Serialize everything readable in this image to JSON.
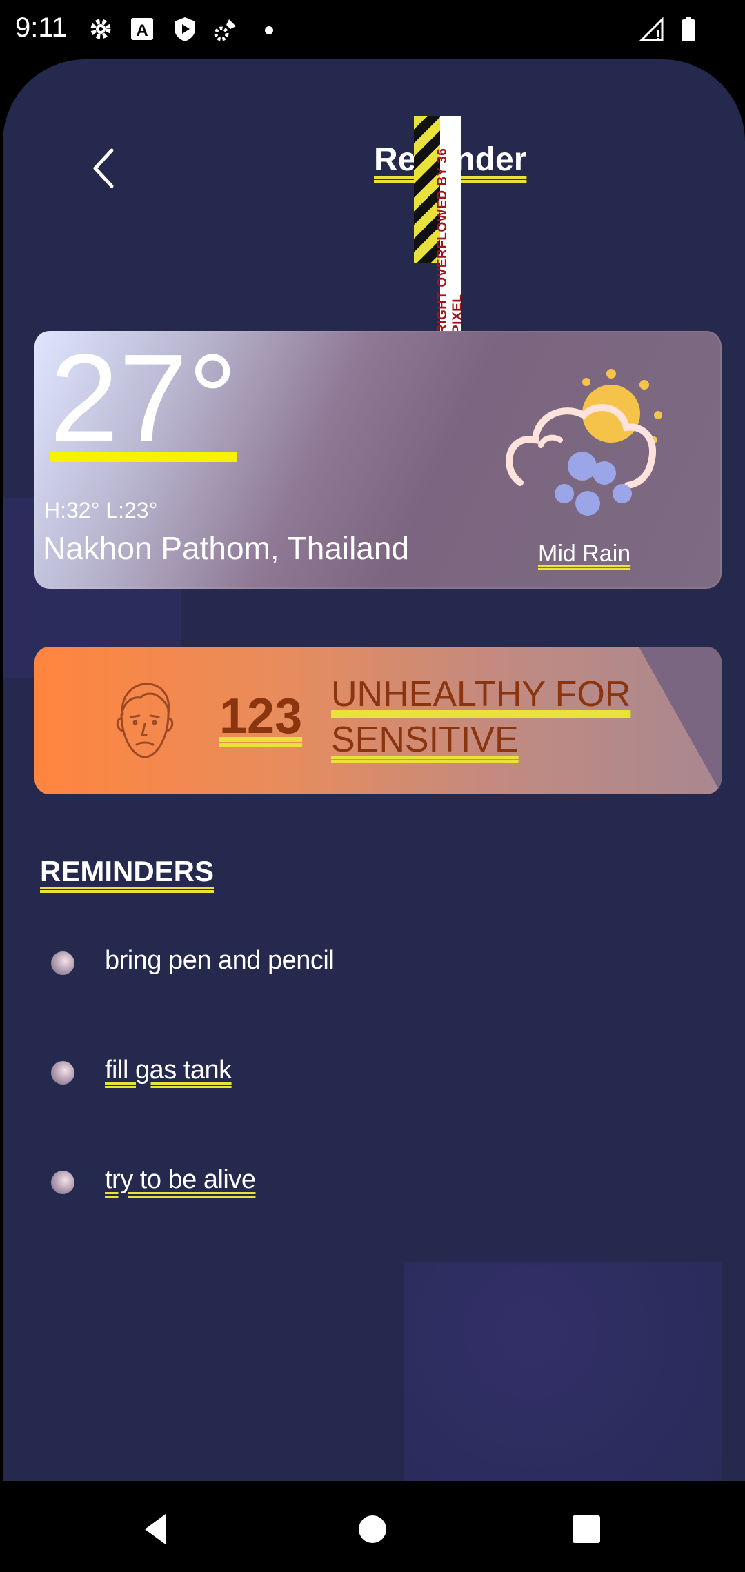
{
  "status_bar": {
    "time": "9:11",
    "icons": [
      "gear-icon",
      "font-icon",
      "shield-icon",
      "satellite-icon",
      "dot-icon",
      "signal-icon",
      "battery-icon"
    ]
  },
  "header": {
    "title": "Reminder",
    "overflow_warning": "RIGHT OVERFLOWED BY 36 PIXEL"
  },
  "weather": {
    "temperature": "27°",
    "high_low": "H:32°  L:23°",
    "location": "Nakhon Pathom, Thailand",
    "condition": "Mid Rain",
    "icon": "cloud-rain-sun-icon"
  },
  "air_quality": {
    "value": "123",
    "label": "UNHEALTHY FOR SENSITIVE",
    "icon": "sad-face-icon"
  },
  "reminders": {
    "title": "REMINDERS",
    "items": [
      {
        "text": "bring pen and pencil"
      },
      {
        "text": "fill gas tank"
      },
      {
        "text": "try to be alive"
      }
    ]
  },
  "colors": {
    "background": "#24294d",
    "accent_yellow": "#e8e23a",
    "aqi_orange": "#ff853e",
    "aqi_text": "#8a3510"
  }
}
